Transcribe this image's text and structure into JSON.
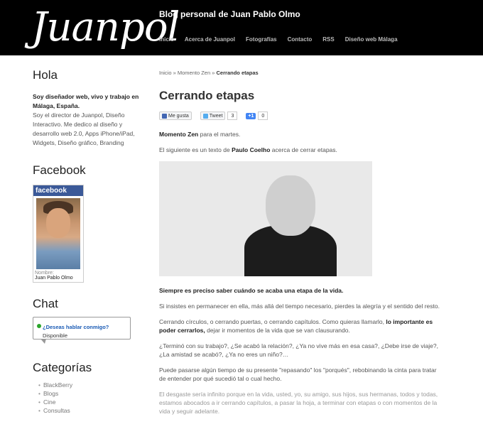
{
  "header": {
    "logo": "Juanpol",
    "tagline": "Blog personal de Juan Pablo Olmo",
    "nav": [
      "Inicio",
      "Acerca de Juanpol",
      "Fotografías",
      "Contacto",
      "RSS",
      "Diseño web Málaga"
    ]
  },
  "sidebar": {
    "hola_title": "Hola",
    "intro_bold": "Soy diseñador web, vivo y trabajo en Málaga, España.",
    "intro_text": "Soy el director de Juanpol, Diseño Interactivo. Me dedico al diseño y desarrollo web 2.0, Apps iPhone/iPad, Widgets, Diseño gráfico, Branding",
    "facebook_title": "Facebook",
    "facebook_badge": "facebook",
    "fb_label": "Nombre:",
    "fb_name": "Juan Pablo Olmo",
    "chat_title": "Chat",
    "chat_link": "¿Deseas hablar conmigo?",
    "chat_status": "Disponible",
    "categorias_title": "Categorías",
    "categorias": [
      "BlackBerry",
      "Blogs",
      "Cine",
      "Consultas"
    ]
  },
  "main": {
    "breadcrumb_home": "Inicio",
    "breadcrumb_sep": "»",
    "breadcrumb_cat": "Momento Zen",
    "breadcrumb_current": "Cerrando etapas",
    "title": "Cerrando etapas",
    "social": {
      "like": "Me gusta",
      "tweet": "Tweet",
      "tweet_count": "3",
      "plus_one": "+1",
      "plus_count": "0"
    },
    "p1_bold": "Momento Zen",
    "p1_rest": " para el martes.",
    "p2_start": "El siguiente es un texto de ",
    "p2_bold": "Paulo Coelho",
    "p2_end": " acerca de cerrar etapas.",
    "p3_bold": "Siempre es preciso saber cuándo se acaba una etapa de la vida.",
    "p4": "Si insistes en permanecer en ella, más allá del tiempo necesario, pierdes la alegría y el sentido del resto.",
    "p5_start": "Cerrando círculos, o cerrando puertas, o cerrando capítulos. Como quieras llamarlo, ",
    "p5_bold": "lo importante es poder cerrarlos,",
    "p5_end": " dejar ir momentos de la vida que se van clausurando.",
    "p6": "¿Terminó con su trabajo?, ¿Se acabó la relación?, ¿Ya no vive más en esa casa?, ¿Debe irse de viaje?, ¿La amistad se acabó?, ¿Ya no eres un niño?…",
    "p7": "Puede pasarse algún tiempo de su presente \"repasando\" los \"porqués\", rebobinando la cinta para tratar de entender por qué sucedió tal o cual hecho.",
    "p8": "El desgaste sería infinito porque en la vida, usted, yo, su amigo, sus hijos, sus hermanas, todos y todas, estamos abocados a ir cerrando capítulos, a pasar la hoja, a terminar con etapas o con momentos de la vida y seguir adelante."
  }
}
